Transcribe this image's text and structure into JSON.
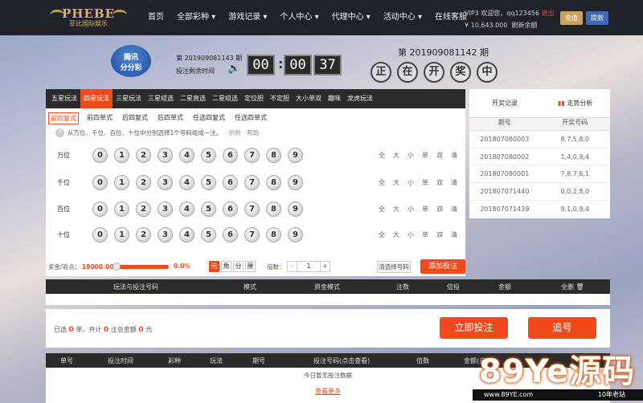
{
  "brand": {
    "logo_text": "PHEBE",
    "logo_sub": "菲比国际娱乐"
  },
  "nav": {
    "items": [
      "首页",
      "全部彩种 ▾",
      "游戏记录 ▾",
      "个人中心 ▾",
      "代理中心 ▾",
      "活动中心 ▾",
      "在线客服"
    ]
  },
  "user": {
    "greeting": "VIP3 欢迎您，",
    "username": "qq123456",
    "logout": "退出",
    "balance": "¥ 10,643.000",
    "refresh": "刷新余额",
    "charge": "充值",
    "withdraw": "提款"
  },
  "lottery": {
    "logo_line1": "腾讯",
    "logo_line2": "分分彩",
    "current_period": "第 201909081143 期",
    "countdown_label": "投注剩余时间",
    "hh": "00",
    "mm": "00",
    "ss": "37",
    "open_period": "第 201909081142 期",
    "open_chars": [
      "正",
      "在",
      "开",
      "奖",
      "中"
    ]
  },
  "play_tabs": [
    "五星玩法",
    "四星玩法",
    "三星玩法",
    "三星组选",
    "二星直选",
    "二星组选",
    "定位胆",
    "不定胆",
    "大小单双",
    "趣味",
    "龙虎玩法"
  ],
  "sub_tabs": [
    "前四复式",
    "前四单式",
    "后四复式",
    "后四单式",
    "任选四复式",
    "任选四单式"
  ],
  "hint": {
    "icon": "?",
    "text": "从万位、千位、百位、十位中分别选择1个号码组成一注。",
    "example": "示例",
    "help": "帮助"
  },
  "rows": [
    {
      "label": "万位"
    },
    {
      "label": "千位"
    },
    {
      "label": "百位"
    },
    {
      "label": "十位"
    }
  ],
  "digits": [
    "0",
    "1",
    "2",
    "3",
    "4",
    "5",
    "6",
    "7",
    "8",
    "9"
  ],
  "quick": [
    "全",
    "大",
    "小",
    "单",
    "双",
    "清"
  ],
  "bet": {
    "rebate_label": "奖金/返点：",
    "rebate_value": "19000.00",
    "rebate_pct": "0.0%",
    "units": [
      "元",
      "角",
      "分",
      "厘"
    ],
    "mult_label": "倍数：",
    "minus": "-",
    "mult_value": "1",
    "plus": "+",
    "clear": "清选择号码",
    "add": "添加投注"
  },
  "history": {
    "title": "开奖记录",
    "trend": "走势分析",
    "col_period": "期号",
    "col_numbers": "开奖号码",
    "rows": [
      {
        "period": "201807080003",
        "numbers": "8,7,5,8,0"
      },
      {
        "period": "201807080002",
        "numbers": "1,4,0,9,4"
      },
      {
        "period": "201807080001",
        "numbers": "7,8,7,6,1"
      },
      {
        "period": "201807071440",
        "numbers": "0,0,2,8,0"
      },
      {
        "period": "201807071439",
        "numbers": "9,1,0,9,4"
      }
    ]
  },
  "cart": {
    "cols": [
      "玩法与投注号码",
      "模式",
      "资金模式",
      "注数",
      "倍投",
      "金额",
      "全删 🗑"
    ]
  },
  "summary": {
    "pre": "已选",
    "count": "0",
    "unit1": "单，共计",
    "bets": "0",
    "unit2": "注总金额",
    "amount": "0",
    "unit3": "元",
    "now": "立即投注",
    "chase": "追号"
  },
  "records": {
    "cols": [
      "单号",
      "投注时间",
      "彩种",
      "玩法",
      "期号",
      "投注号码(点击查看)",
      "倍数",
      "金额(元)"
    ],
    "empty": "今日暂无投注数据",
    "more": "查看更多"
  },
  "watermark": {
    "big": "89Ye源码",
    "url": "www.89YE.com",
    "tag": "10年老站"
  }
}
